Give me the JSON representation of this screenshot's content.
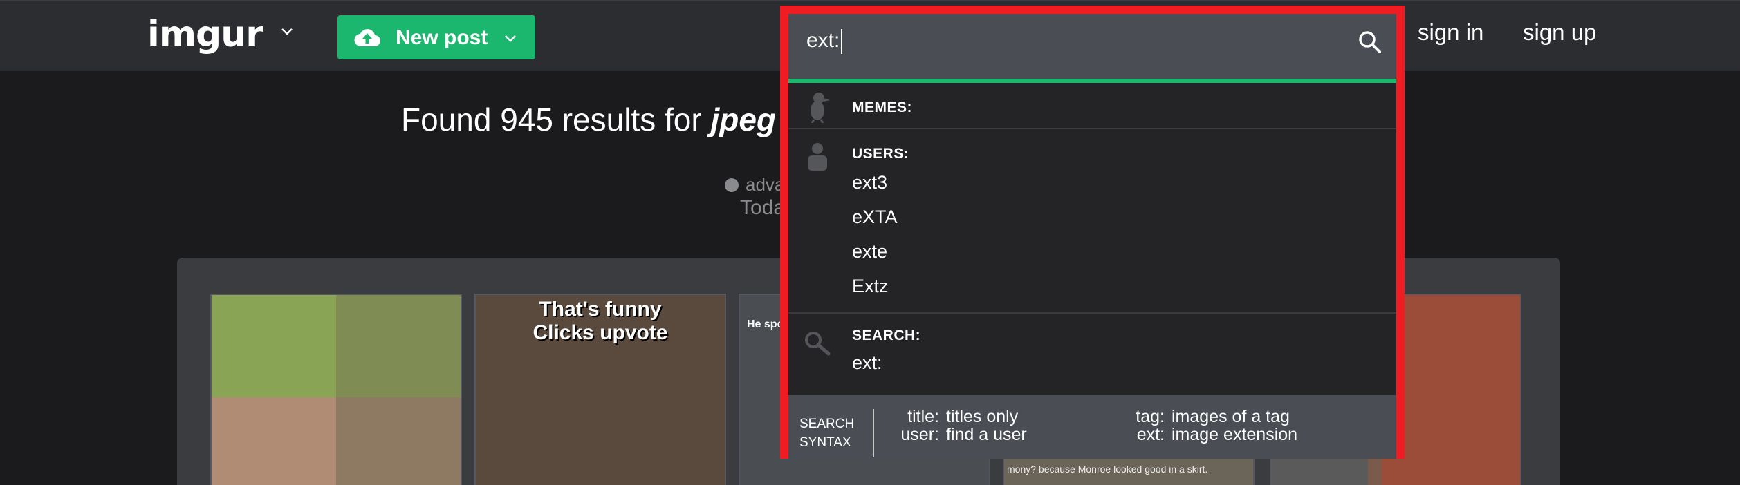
{
  "header": {
    "logo": "imgur",
    "new_post_label": "New post",
    "sign_in": "sign in",
    "sign_up": "sign up"
  },
  "results": {
    "prefix": "Found 945 results for ",
    "query": "jpeg",
    "advanced_fragment": "adva",
    "today_fragment": "Toda"
  },
  "gallery": {
    "thumb2_caption_line1": "That's funny",
    "thumb2_caption_line2": "Clicks upvote",
    "thumb3_caption": "He spoli",
    "thumb4_caption": "mony? because Monroe looked good in a skirt."
  },
  "search": {
    "value": "ext:",
    "memes_heading": "MEMES:",
    "users_heading": "USERS:",
    "users": [
      "ext3",
      "eXTA",
      "exte",
      "Extz"
    ],
    "search_heading": "SEARCH:",
    "search_suggestion": "ext:"
  },
  "syntax": {
    "title_line1": "SEARCH",
    "title_line2": "SYNTAX",
    "entries": [
      {
        "key": "title:",
        "desc": "titles only"
      },
      {
        "key": "user:",
        "desc": "find a user"
      },
      {
        "key": "tag:",
        "desc": "images of a tag"
      },
      {
        "key": "ext:",
        "desc": "image extension"
      }
    ]
  },
  "colors": {
    "accent_green": "#1bb76e",
    "highlight_red": "#ef1d23",
    "topbar": "#2c2d31",
    "background": "#1b1b1d"
  },
  "icons": [
    "chevron-down-icon",
    "cloud-upload-icon",
    "search-icon",
    "meme-icon",
    "user-icon",
    "magnifier-icon"
  ]
}
